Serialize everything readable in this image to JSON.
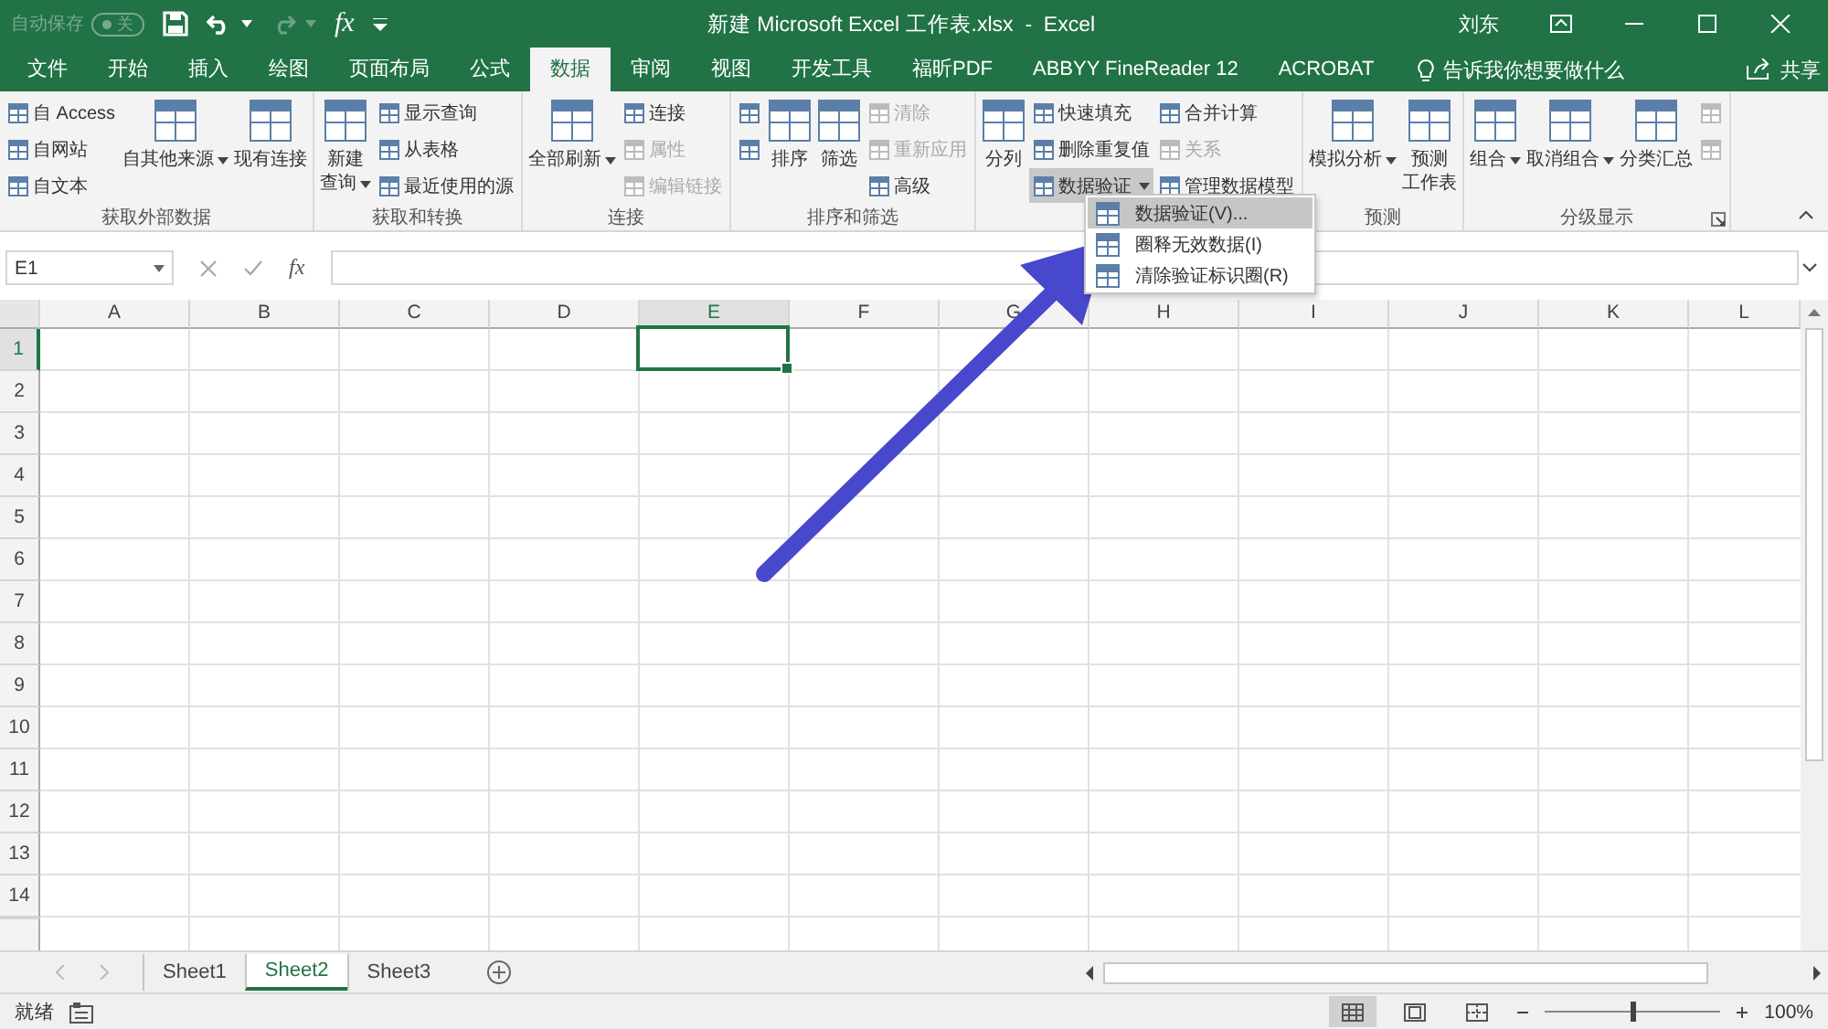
{
  "title_bar": {
    "autosave": {
      "label": "自动保存",
      "toggle": "关",
      "on": false
    },
    "quick_access": [
      {
        "kind": "save"
      },
      {
        "kind": "undo",
        "dropdown": true
      },
      {
        "kind": "redo",
        "dropdown": true,
        "disabled": true
      },
      {
        "kind": "text",
        "label": "fx"
      },
      {
        "kind": "customize"
      }
    ],
    "title": "新建 Microsoft Excel 工作表.xlsx  -  Excel",
    "user": "刘东"
  },
  "tabs": [
    {
      "label": "文件",
      "selected": false
    },
    {
      "label": "开始",
      "selected": false
    },
    {
      "label": "插入",
      "selected": false
    },
    {
      "label": "绘图",
      "selected": false
    },
    {
      "label": "页面布局",
      "selected": false
    },
    {
      "label": "公式",
      "selected": false
    },
    {
      "label": "数据",
      "selected": true
    },
    {
      "label": "审阅",
      "selected": false
    },
    {
      "label": "视图",
      "selected": false
    },
    {
      "label": "开发工具",
      "selected": false
    },
    {
      "label": "福昕PDF",
      "selected": false
    },
    {
      "label": "ABBYY FineReader 12",
      "selected": false
    },
    {
      "label": "ACROBAT",
      "selected": false
    }
  ],
  "tell_me": "告诉我你想要做什么",
  "share": "共享",
  "ribbon": {
    "groups": [
      {
        "label": "获取外部数据",
        "items": [
          {
            "kind": "small",
            "label": "自 Access"
          },
          {
            "kind": "small",
            "label": "自网站"
          },
          {
            "kind": "small",
            "label": "自文本"
          },
          {
            "kind": "large",
            "label": "自其他来源",
            "dropdown": true
          },
          {
            "kind": "large",
            "label": "现有连接"
          }
        ]
      },
      {
        "label": "获取和转换",
        "items": [
          {
            "kind": "large",
            "lines": [
              "新建",
              "查询"
            ],
            "dropdown": true
          },
          {
            "kind": "small",
            "label": "显示查询"
          },
          {
            "kind": "small",
            "label": "从表格"
          },
          {
            "kind": "small",
            "label": "最近使用的源"
          }
        ]
      },
      {
        "label": "连接",
        "items": [
          {
            "kind": "large",
            "label": "全部刷新",
            "dropdown": true
          },
          {
            "kind": "small",
            "label": "连接"
          },
          {
            "kind": "small",
            "label": "属性",
            "disabled": true
          },
          {
            "kind": "small",
            "label": "编辑链接",
            "disabled": true
          }
        ]
      },
      {
        "label": "排序和筛选",
        "items": [
          {
            "kind": "icon"
          },
          {
            "kind": "icon"
          },
          {
            "kind": "large",
            "label": "排序"
          },
          {
            "kind": "large",
            "label": "筛选"
          },
          {
            "kind": "small",
            "label": "清除",
            "disabled": true
          },
          {
            "kind": "small",
            "label": "重新应用",
            "disabled": true
          },
          {
            "kind": "small",
            "label": "高级"
          }
        ]
      },
      {
        "items": [
          {
            "kind": "large",
            "label": "分列"
          },
          {
            "kind": "small",
            "label": "快速填充"
          },
          {
            "kind": "small",
            "label": "删除重复值"
          },
          {
            "kind": "small",
            "label": "数据验证",
            "dropdown": true,
            "pressed": true
          },
          {
            "kind": "small",
            "label": "合并计算"
          },
          {
            "kind": "small",
            "label": "关系",
            "disabled": true
          },
          {
            "kind": "small",
            "label": "管理数据模型"
          }
        ]
      },
      {
        "label": "预测",
        "items": [
          {
            "kind": "large",
            "label": "模拟分析",
            "dropdown": true
          },
          {
            "kind": "large",
            "lines": [
              "预测",
              "工作表"
            ]
          }
        ]
      },
      {
        "label": "分级显示",
        "launcher": true,
        "items": [
          {
            "kind": "large",
            "label": "组合",
            "dropdown": true
          },
          {
            "kind": "large",
            "label": "取消组合",
            "dropdown": true
          },
          {
            "kind": "large",
            "label": "分类汇总"
          },
          {
            "kind": "icon",
            "disabled": true
          },
          {
            "kind": "icon",
            "disabled": true
          }
        ]
      }
    ]
  },
  "dropdown_menu": [
    {
      "label": "数据验证(V)...",
      "selected": true
    },
    {
      "label": "圈释无效数据(I)",
      "selected": false
    },
    {
      "label": "清除验证标识圈(R)",
      "selected": false
    }
  ],
  "formula_bar": {
    "name_box": "E1",
    "fx": "fx"
  },
  "grid": {
    "columns": [
      {
        "label": "A",
        "selected": false
      },
      {
        "label": "B",
        "selected": false
      },
      {
        "label": "C",
        "selected": false
      },
      {
        "label": "D",
        "selected": false
      },
      {
        "label": "E",
        "selected": true
      },
      {
        "label": "F",
        "selected": false
      },
      {
        "label": "G",
        "selected": false
      },
      {
        "label": "H",
        "selected": false
      },
      {
        "label": "I",
        "selected": false
      },
      {
        "label": "J",
        "selected": false
      },
      {
        "label": "K",
        "selected": false
      },
      {
        "label": "L",
        "selected": false
      }
    ],
    "rows": [
      {
        "label": "1",
        "selected": true
      },
      {
        "label": "2",
        "selected": false
      },
      {
        "label": "3",
        "selected": false
      },
      {
        "label": "4",
        "selected": false
      },
      {
        "label": "5",
        "selected": false
      },
      {
        "label": "6",
        "selected": false
      },
      {
        "label": "7",
        "selected": false
      },
      {
        "label": "8",
        "selected": false
      },
      {
        "label": "9",
        "selected": false
      },
      {
        "label": "10",
        "selected": false
      },
      {
        "label": "11",
        "selected": false
      },
      {
        "label": "12",
        "selected": false
      },
      {
        "label": "13",
        "selected": false
      },
      {
        "label": "14",
        "selected": false
      }
    ]
  },
  "sheets": [
    {
      "label": "Sheet1",
      "selected": false
    },
    {
      "label": "Sheet2",
      "selected": true
    },
    {
      "label": "Sheet3",
      "selected": false
    }
  ],
  "status_bar": {
    "text": "就绪",
    "views": [
      {
        "selected": true
      },
      {
        "selected": false
      },
      {
        "selected": false
      }
    ],
    "zoom": {
      "level": 0.5,
      "reading": "100%"
    }
  }
}
